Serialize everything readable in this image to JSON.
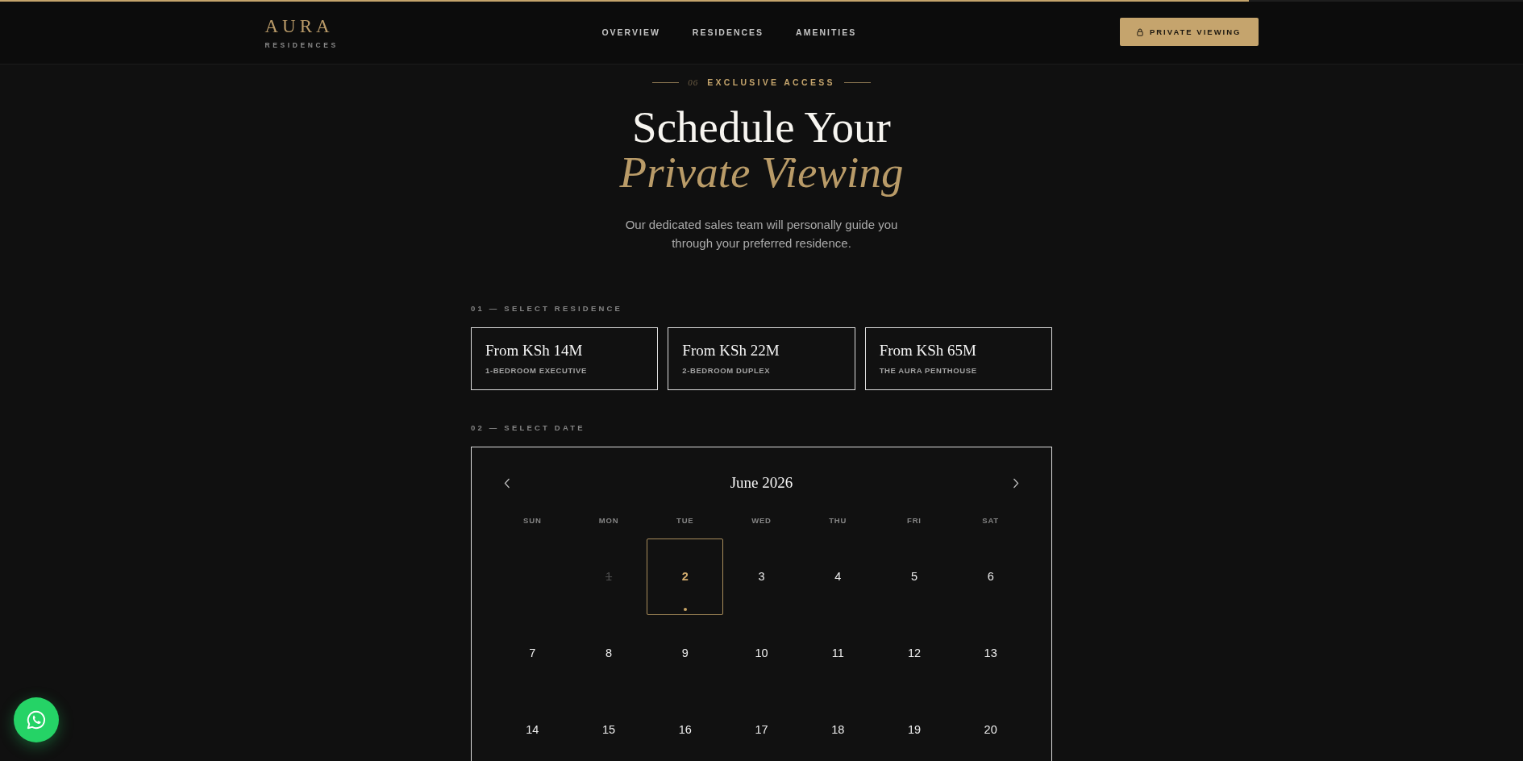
{
  "reading_progress": {
    "level": 0.82
  },
  "header": {
    "logo": {
      "wordmark": "AURA",
      "tagline": "RESIDENCES"
    },
    "nav": [
      {
        "label": "OVERVIEW"
      },
      {
        "label": "RESIDENCES"
      },
      {
        "label": "AMENITIES"
      }
    ],
    "cta": {
      "label": "PRIVATE VIEWING"
    }
  },
  "hero": {
    "eyebrow": {
      "number": "06",
      "label": "EXCLUSIVE ACCESS"
    },
    "title": "Schedule Your *Private Viewing*",
    "subtitle": "Our dedicated sales team will personally guide you through your preferred residence."
  },
  "residence_step": {
    "label": "01 — SELECT RESIDENCE",
    "options": [
      {
        "price": "From KSh 14M",
        "name": "1-BEDROOM EXECUTIVE",
        "selected": false
      },
      {
        "price": "From KSh 22M",
        "name": "2-BEDROOM DUPLEX",
        "selected": false
      },
      {
        "price": "From KSh 65M",
        "name": "THE AURA PENTHOUSE",
        "selected": false
      }
    ]
  },
  "date_step": {
    "label": "02 — SELECT DATE",
    "calendar": {
      "month": "June 2026",
      "weekdays": [
        "SUN",
        "MON",
        "TUE",
        "WED",
        "THU",
        "FRI",
        "SAT"
      ],
      "days": [
        {
          "kind": "blank"
        },
        {
          "kind": "day",
          "label": "1",
          "selected": false,
          "disabled": true,
          "today": false
        },
        {
          "kind": "day",
          "label": "2",
          "selected": true,
          "disabled": false,
          "today": true
        },
        {
          "kind": "day",
          "label": "3",
          "selected": false,
          "disabled": false,
          "today": false
        },
        {
          "kind": "day",
          "label": "4",
          "selected": false,
          "disabled": false,
          "today": false
        },
        {
          "kind": "day",
          "label": "5",
          "selected": false,
          "disabled": false,
          "today": false
        },
        {
          "kind": "day",
          "label": "6",
          "selected": false,
          "disabled": false,
          "today": false
        },
        {
          "kind": "day",
          "label": "7",
          "selected": false,
          "disabled": false,
          "today": false
        },
        {
          "kind": "day",
          "label": "8",
          "selected": false,
          "disabled": false,
          "today": false
        },
        {
          "kind": "day",
          "label": "9",
          "selected": false,
          "disabled": false,
          "today": false
        },
        {
          "kind": "day",
          "label": "10",
          "selected": false,
          "disabled": false,
          "today": false
        },
        {
          "kind": "day",
          "label": "11",
          "selected": false,
          "disabled": false,
          "today": false
        },
        {
          "kind": "day",
          "label": "12",
          "selected": false,
          "disabled": false,
          "today": false
        },
        {
          "kind": "day",
          "label": "13",
          "selected": false,
          "disabled": false,
          "today": false
        },
        {
          "kind": "day",
          "label": "14",
          "selected": false,
          "disabled": false,
          "today": false
        },
        {
          "kind": "day",
          "label": "15",
          "selected": false,
          "disabled": false,
          "today": false
        },
        {
          "kind": "day",
          "label": "16",
          "selected": false,
          "disabled": false,
          "today": false
        },
        {
          "kind": "day",
          "label": "17",
          "selected": false,
          "disabled": false,
          "today": false
        },
        {
          "kind": "day",
          "label": "18",
          "selected": false,
          "disabled": false,
          "today": false
        },
        {
          "kind": "day",
          "label": "19",
          "selected": false,
          "disabled": false,
          "today": false
        },
        {
          "kind": "day",
          "label": "20",
          "selected": false,
          "disabled": false,
          "today": false
        }
      ]
    }
  }
}
